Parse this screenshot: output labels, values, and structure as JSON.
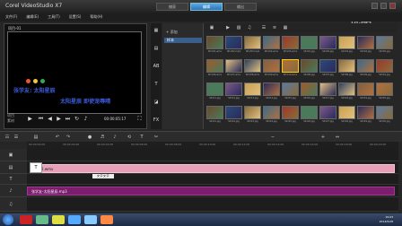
{
  "app": {
    "title": "Corel VideoStudio X7"
  },
  "mode_tabs": [
    "捕获",
    "编辑",
    "输出"
  ],
  "menu": [
    "文件(F)",
    "编辑(E)",
    "工具(T)",
    "设置(S)",
    "帮助(H)"
  ],
  "preview": {
    "label": "项目-01",
    "line1": "张学友:  太阳星辰",
    "line2": "太阳星辰  即使宠辱晴",
    "modes": [
      "项目",
      "素材"
    ],
    "timecode": "00:00:05:17"
  },
  "library": {
    "add_label": "添加",
    "folder": "样本"
  },
  "thumbs": [
    "SP-V01.wmv",
    "SP-V02.mp4",
    "SP-V03.mp4",
    "SP-V04.wmv",
    "SP-V05.wmv",
    "SP-I01.jpg",
    "SP-I02.jpg",
    "SP-I03.jpg",
    "SP-I04.jpg",
    "SP-I05.jpg",
    "SP-V06.wmv",
    "SP-V07.wmv",
    "SP-V08.wmv",
    "SP-V09.wmv",
    "SP-V10.wmv",
    "SP-I06.jpg",
    "SP-I07.jpg",
    "SP-I08.jpg",
    "SP-I09.jpg",
    "SP-I10.jpg",
    "SP-I11.jpg",
    "SP-I12.jpg",
    "SP-I13.jpg",
    "SP-I14.jpg",
    "SP-I15.jpg",
    "SP-I16.jpg",
    "SP-I17.jpg",
    "SP-I18.jpg",
    "SP-I19.jpg",
    "SP-I20.jpg",
    "SP-I21.jpg",
    "SP-I22.jpg",
    "SP-I23.jpg",
    "SP-I24.jpg",
    "SP-I25.jpg",
    "SP-I26.jpg",
    "SP-I27.jpg",
    "SP-I28.jpg",
    "SP-I29.jpg",
    "SP-I30.jpg"
  ],
  "ruler": [
    "00:00:00:00",
    "00:00:02:00",
    "00:00:04:00",
    "00:00:06:00",
    "00:00:08:00",
    "00:00:10:00",
    "00:00:12:00",
    "00:00:14:00",
    "00:00:16:00",
    "00:00:18:00",
    "00:00:20:00"
  ],
  "timeline": {
    "title_clip": "2.wmv",
    "audio_clip": "张学友-太阳星辰.mp3",
    "tooltip": "文字文字"
  },
  "taskbar": {
    "time": "19:03",
    "date": "2014/5/28"
  },
  "watermark": "优酷",
  "colors": {
    "accent": "#2d73b8",
    "video_clip": "#e8a0b8",
    "music_clip": "#7c1e6e",
    "title_text": "#3d5bd9"
  }
}
